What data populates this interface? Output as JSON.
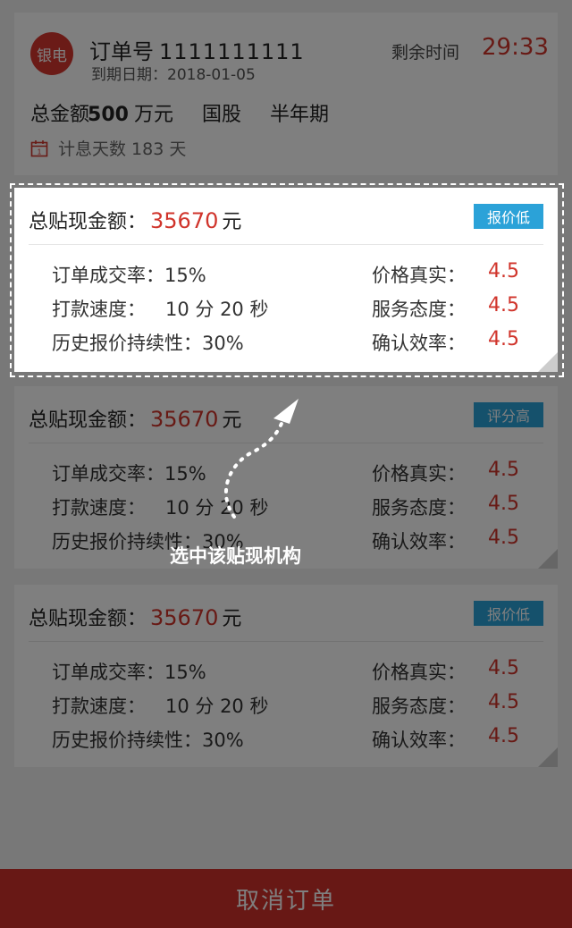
{
  "order": {
    "bank_logo": "银电",
    "order_no_label": "订单号",
    "order_no": "1111111111",
    "due_date": "到期日期：2018-01-05",
    "remain_label": "剩余时间",
    "remain_time": "29:33",
    "total_label": "总金额",
    "total_amount": "500",
    "total_unit": "万元",
    "bond_type": "国股",
    "term": "半年期",
    "calendar_icon": "calendar-icon",
    "interest_days": "计息天数 183 天"
  },
  "quotes": [
    {
      "title_label": "总贴现金额：",
      "amount": "35670",
      "unit": "元",
      "badge": "报价低",
      "deal_rate": "订单成交率：15%",
      "pay_speed_label": "打款速度：",
      "pay_speed": "10 分 20 秒",
      "history": "历史报价持续性：30%",
      "price_label": "价格真实：",
      "price_score": "4.5",
      "service_label": "服务态度：",
      "service_score": "4.5",
      "confirm_label": "确认效率：",
      "confirm_score": "4.5"
    },
    {
      "title_label": "总贴现金额：",
      "amount": "35670",
      "unit": "元",
      "badge": "评分高",
      "deal_rate": "订单成交率：15%",
      "pay_speed_label": "打款速度：",
      "pay_speed": "10 分 20 秒",
      "history": "历史报价持续性：30%",
      "price_label": "价格真实：",
      "price_score": "4.5",
      "service_label": "服务态度：",
      "service_score": "4.5",
      "confirm_label": "确认效率：",
      "confirm_score": "4.5"
    },
    {
      "title_label": "总贴现金额：",
      "amount": "35670",
      "unit": "元",
      "badge": "报价低",
      "deal_rate": "订单成交率：15%",
      "pay_speed_label": "打款速度：",
      "pay_speed": "10 分 20 秒",
      "history": "历史报价持续性：30%",
      "price_label": "价格真实：",
      "price_score": "4.5",
      "service_label": "服务态度：",
      "service_score": "4.5",
      "confirm_label": "确认效率：",
      "confirm_score": "4.5"
    }
  ],
  "guide": {
    "text": "选中该贴现机构",
    "arrow_icon": "curved-arrow-icon"
  },
  "footer": {
    "cancel_label": "取消订单"
  },
  "colors": {
    "accent_red": "#d0342b",
    "badge_blue": "#2ba2d8",
    "footer_red": "#d1312a",
    "overlay": "rgba(0,0,0,0.5)"
  }
}
